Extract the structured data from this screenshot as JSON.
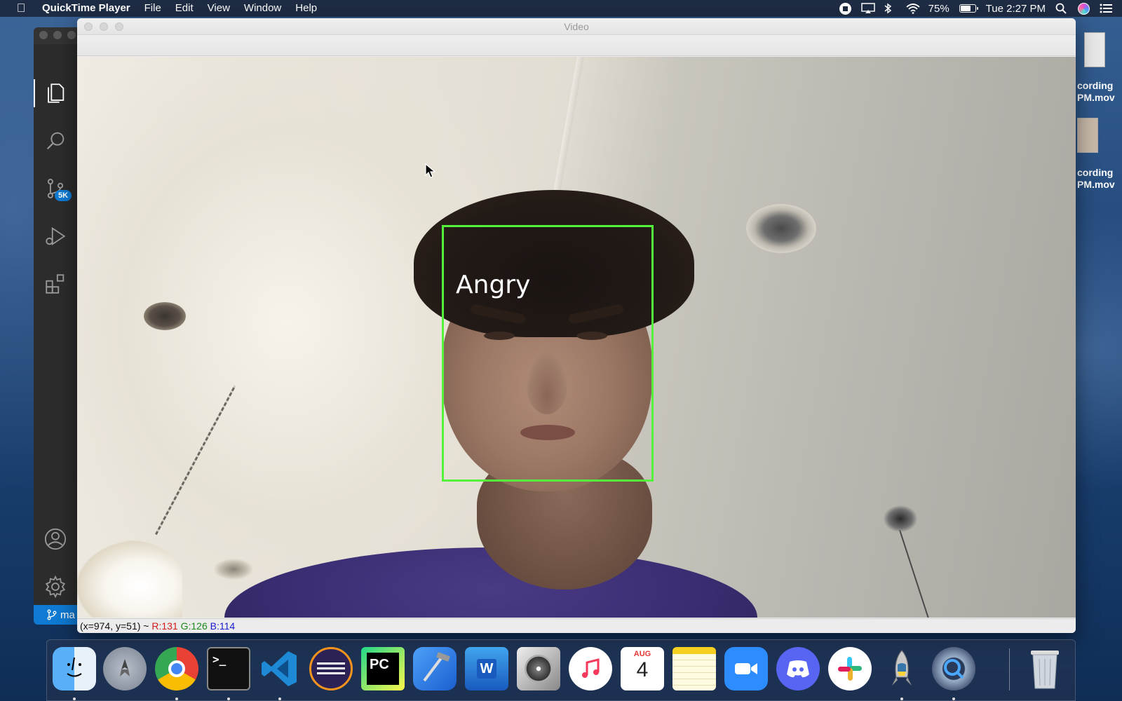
{
  "menubar": {
    "app_name": "QuickTime Player",
    "menus": [
      "File",
      "Edit",
      "View",
      "Window",
      "Help"
    ],
    "battery_percent": "75%",
    "battery_level": 0.75,
    "clock": "Tue 2:27 PM"
  },
  "vscode": {
    "scm_badge": "5K",
    "branch_label": "ma"
  },
  "video_window": {
    "title": "Video",
    "detection_label": "Angry",
    "status": {
      "coords": "(x=974, y=51) ~",
      "r": "R:131",
      "g": "G:126",
      "b": "B:114"
    }
  },
  "desktop_files": [
    {
      "line1": "cording",
      "line2": "PM.mov"
    },
    {
      "line1": "cording",
      "line2": "PM.mov"
    }
  ],
  "dock": {
    "calendar_month": "AUG",
    "calendar_day": "4",
    "pycharm_label": "PC",
    "word_label": "W"
  },
  "colors": {
    "detection_box": "#55f23c",
    "vscode_blue": "#0e7ad3"
  }
}
